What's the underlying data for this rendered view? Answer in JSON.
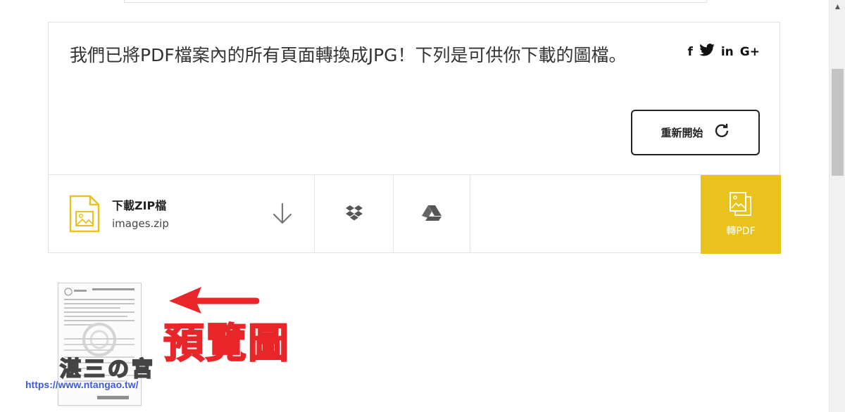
{
  "result": {
    "message": "我們已將PDF檔案內的所有頁面轉換成JPG！下列是可供你下載的圖檔。",
    "share_icons": [
      "facebook-icon",
      "twitter-icon",
      "linkedin-icon",
      "google-plus-icon"
    ],
    "share_glyphs": {
      "facebook": "f",
      "twitter": "🐦",
      "linkedin": "in",
      "google_plus": "G+"
    },
    "restart_label": "重新開始"
  },
  "download": {
    "title": "下載ZIP檔",
    "filename": "images.zip"
  },
  "convert": {
    "label": "轉PDF"
  },
  "annotation": {
    "label": "預覽圖"
  },
  "watermark": {
    "logo": "湛三の宮",
    "url": "https://www.ntangao.tw/"
  },
  "colors": {
    "accent": "#e9c21e",
    "annotation": "#e8262a",
    "file_icon": "#e9c21e"
  }
}
